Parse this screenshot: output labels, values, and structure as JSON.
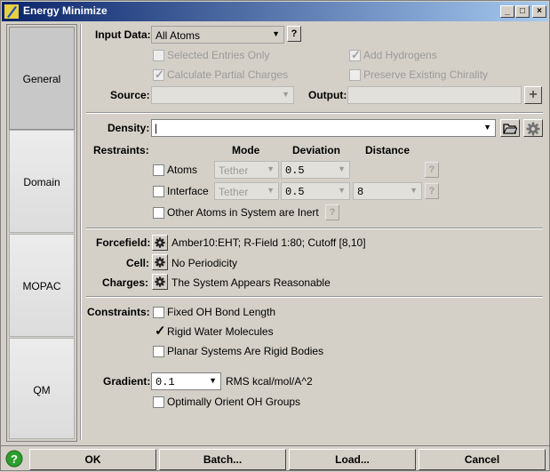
{
  "window": {
    "title": "Energy Minimize"
  },
  "sidebar": {
    "tabs": [
      "General",
      "Domain",
      "MOPAC",
      "QM"
    ]
  },
  "input": {
    "label": "Input Data:",
    "value": "All Atoms",
    "help": "?",
    "selected_only": "Selected Entries Only",
    "add_hydrogens": "Add Hydrogens",
    "partial_charges": "Calculate Partial Charges",
    "preserve_chirality": "Preserve Existing Chirality",
    "source_label": "Source:",
    "output_label": "Output:"
  },
  "density": {
    "label": "Density:",
    "value": ""
  },
  "restraints": {
    "label": "Restraints:",
    "col_mode": "Mode",
    "col_deviation": "Deviation",
    "col_distance": "Distance",
    "atoms": {
      "label": "Atoms",
      "mode": "Tether",
      "deviation": "0.5"
    },
    "interface": {
      "label": "Interface",
      "mode": "Tether",
      "deviation": "0.5",
      "distance": "8"
    },
    "inert": "Other Atoms in System are Inert"
  },
  "forcefield": {
    "label": "Forcefield:",
    "value": "Amber10:EHT;  R-Field 1:80;  Cutoff [8,10]"
  },
  "cell": {
    "label": "Cell:",
    "value": "No Periodicity"
  },
  "charges": {
    "label": "Charges:",
    "value": "The System Appears Reasonable"
  },
  "constraints": {
    "label": "Constraints:",
    "fixed_oh": "Fixed OH Bond Length",
    "rigid_water": "Rigid Water Molecules",
    "planar": "Planar Systems Are Rigid Bodies"
  },
  "gradient": {
    "label": "Gradient:",
    "value": "0.1",
    "units": "RMS kcal/mol/A^2",
    "orient": "Optimally Orient OH Groups"
  },
  "buttons": {
    "ok": "OK",
    "batch": "Batch...",
    "load": "Load...",
    "cancel": "Cancel"
  },
  "colors": {
    "titlebar_start": "#0a246a",
    "titlebar_end": "#a6caf0",
    "help_icon": "#2e9e2e"
  }
}
